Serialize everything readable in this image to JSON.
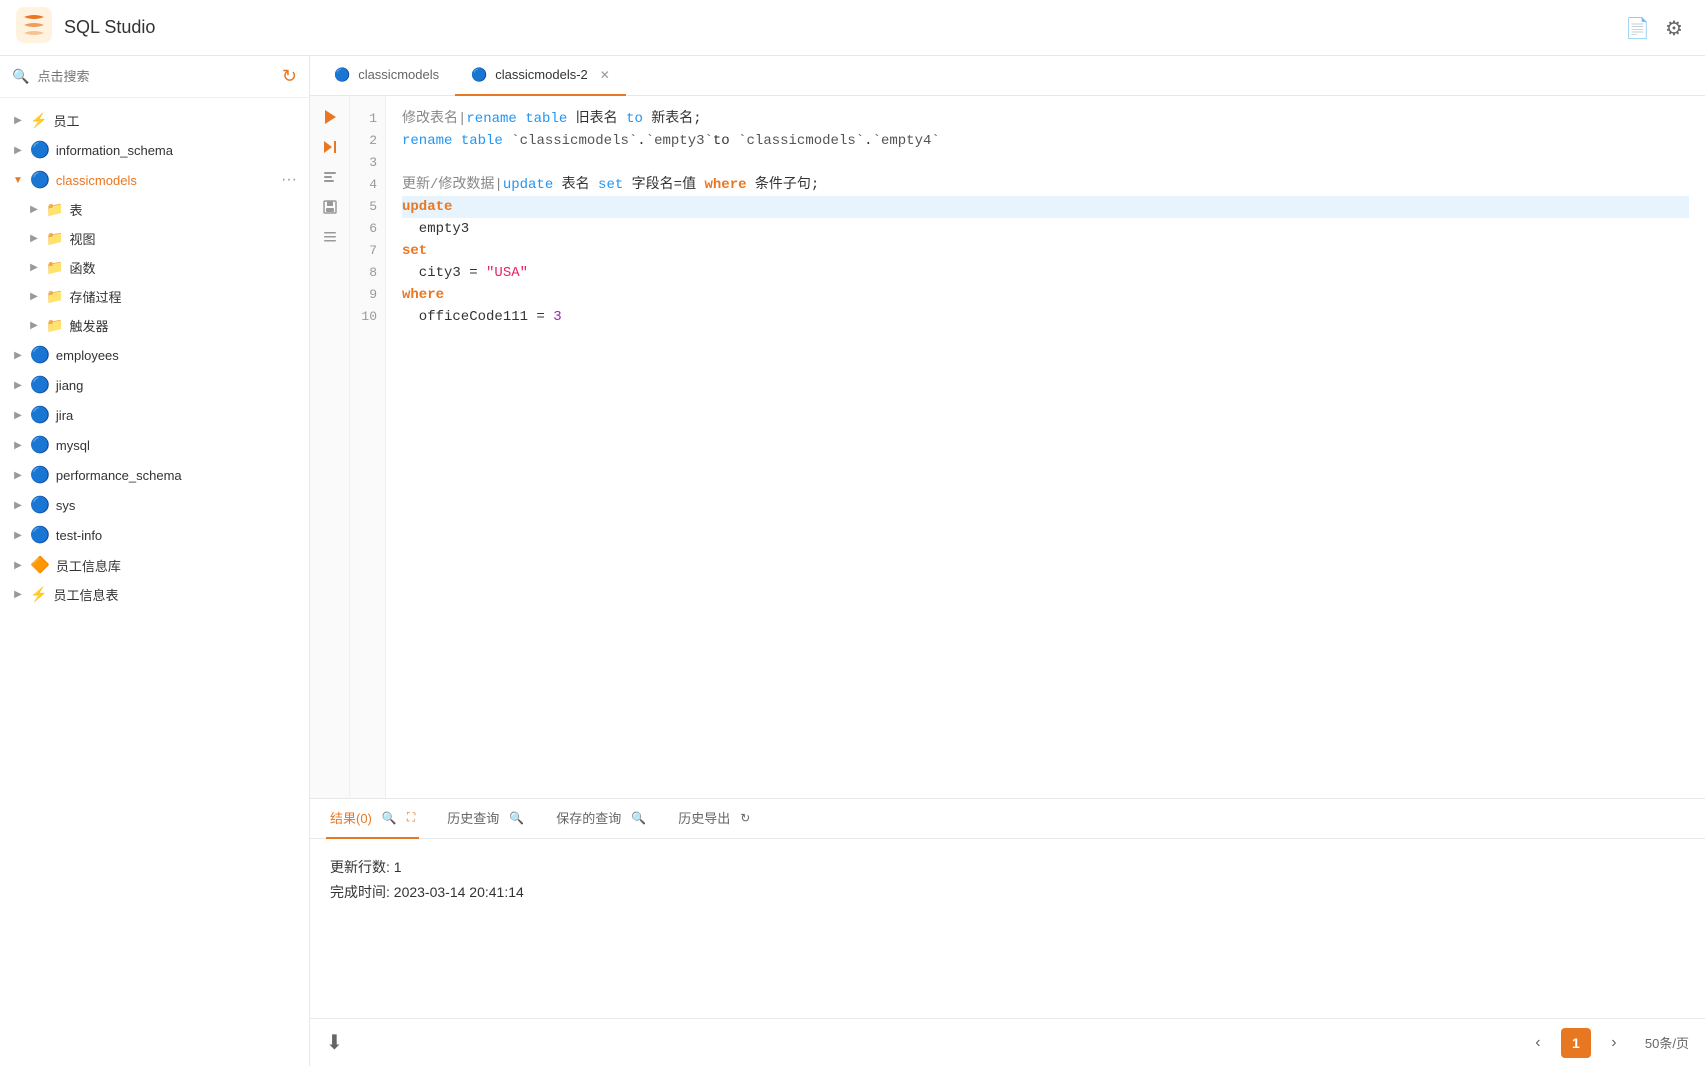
{
  "app": {
    "title": "SQL Studio",
    "logo_alt": "SQL Studio Logo"
  },
  "topbar": {
    "document_icon": "📄",
    "settings_icon": "⚙"
  },
  "sidebar": {
    "search_placeholder": "点击搜索",
    "refresh_icon": "↻",
    "tree": [
      {
        "id": "employees-group",
        "label": "员工",
        "indent": 0,
        "type": "group",
        "expanded": false,
        "icon": "⚡"
      },
      {
        "id": "information_schema",
        "label": "information_schema",
        "indent": 0,
        "type": "db",
        "expanded": false,
        "icon": "🔵"
      },
      {
        "id": "classicmodels",
        "label": "classicmodels",
        "indent": 0,
        "type": "db",
        "expanded": true,
        "icon": "🔵",
        "active": true
      },
      {
        "id": "biao",
        "label": "表",
        "indent": 1,
        "type": "folder",
        "expanded": false,
        "icon": "📁"
      },
      {
        "id": "shitu",
        "label": "视图",
        "indent": 1,
        "type": "folder",
        "expanded": false,
        "icon": "📁"
      },
      {
        "id": "hanshu",
        "label": "函数",
        "indent": 1,
        "type": "folder",
        "expanded": false,
        "icon": "📁"
      },
      {
        "id": "cunchu",
        "label": "存储过程",
        "indent": 1,
        "type": "folder",
        "expanded": false,
        "icon": "📁"
      },
      {
        "id": "chufaqi",
        "label": "触发器",
        "indent": 1,
        "type": "folder",
        "expanded": false,
        "icon": "📁"
      },
      {
        "id": "employees",
        "label": "employees",
        "indent": 0,
        "type": "db",
        "expanded": false,
        "icon": "🔵"
      },
      {
        "id": "jiang",
        "label": "jiang",
        "indent": 0,
        "type": "db",
        "expanded": false,
        "icon": "🔵"
      },
      {
        "id": "jira",
        "label": "jira",
        "indent": 0,
        "type": "db",
        "expanded": false,
        "icon": "🔵"
      },
      {
        "id": "mysql",
        "label": "mysql",
        "indent": 0,
        "type": "db",
        "expanded": false,
        "icon": "🔵"
      },
      {
        "id": "performance_schema",
        "label": "performance_schema",
        "indent": 0,
        "type": "db",
        "expanded": false,
        "icon": "🔵"
      },
      {
        "id": "sys",
        "label": "sys",
        "indent": 0,
        "type": "db",
        "expanded": false,
        "icon": "🔵"
      },
      {
        "id": "test-info",
        "label": "test-info",
        "indent": 0,
        "type": "db",
        "expanded": false,
        "icon": "🔵"
      },
      {
        "id": "employees-db",
        "label": "员工信息库",
        "indent": 0,
        "type": "db-custom",
        "expanded": false,
        "icon": "🔶"
      },
      {
        "id": "employees-table",
        "label": "员工信息表",
        "indent": 0,
        "type": "table-custom",
        "expanded": false,
        "icon": "⚡"
      }
    ]
  },
  "tabs": [
    {
      "id": "classicmodels",
      "label": "classicmodels",
      "active": false,
      "closable": false,
      "icon": "🔵"
    },
    {
      "id": "classicmodels-2",
      "label": "classicmodels-2",
      "active": true,
      "closable": true,
      "icon": "🔵"
    }
  ],
  "editor": {
    "lines": [
      {
        "num": 1,
        "content_raw": "修改表名|rename table 旧表名 to 新表名;",
        "type": "comment-cmd"
      },
      {
        "num": 2,
        "content_raw": "rename table `classicmodels`.`empty3`to `classicmodels`.`empty4`",
        "type": "rename"
      },
      {
        "num": 3,
        "content_raw": "",
        "type": "blank"
      },
      {
        "num": 4,
        "content_raw": "更新/修改数据|update 表名 set 字段名=值 where 条件子句;",
        "type": "comment-cmd2"
      },
      {
        "num": 5,
        "content_raw": "update",
        "type": "kw",
        "highlighted": true
      },
      {
        "num": 6,
        "content_raw": "  empty3",
        "type": "plain"
      },
      {
        "num": 7,
        "content_raw": "set",
        "type": "kw2"
      },
      {
        "num": 8,
        "content_raw": "  city3 = \"USA\"",
        "type": "assign"
      },
      {
        "num": 9,
        "content_raw": "where",
        "type": "kw3"
      },
      {
        "num": 10,
        "content_raw": "  officeCode111 = 3",
        "type": "assign2"
      }
    ],
    "run_buttons": [
      "▶",
      "▶|",
      "📋",
      "📄",
      "≡"
    ]
  },
  "bottom_tabs": [
    {
      "id": "results",
      "label": "结果(0)",
      "active": true,
      "icon": "🔍",
      "extra_icon": "⛶"
    },
    {
      "id": "history",
      "label": "历史查询",
      "active": false,
      "icon": "🔍"
    },
    {
      "id": "saved",
      "label": "保存的查询",
      "active": false,
      "icon": "🔍"
    },
    {
      "id": "export",
      "label": "历史导出",
      "active": false,
      "icon": "↻"
    }
  ],
  "results": {
    "updated_rows": "更新行数: 1",
    "completed_time": "完成时间: 2023-03-14 20:41:14"
  },
  "pagination": {
    "prev_icon": "‹",
    "current_page": "1",
    "next_icon": "›",
    "page_size": "50条/页",
    "download_icon": "⬇"
  }
}
